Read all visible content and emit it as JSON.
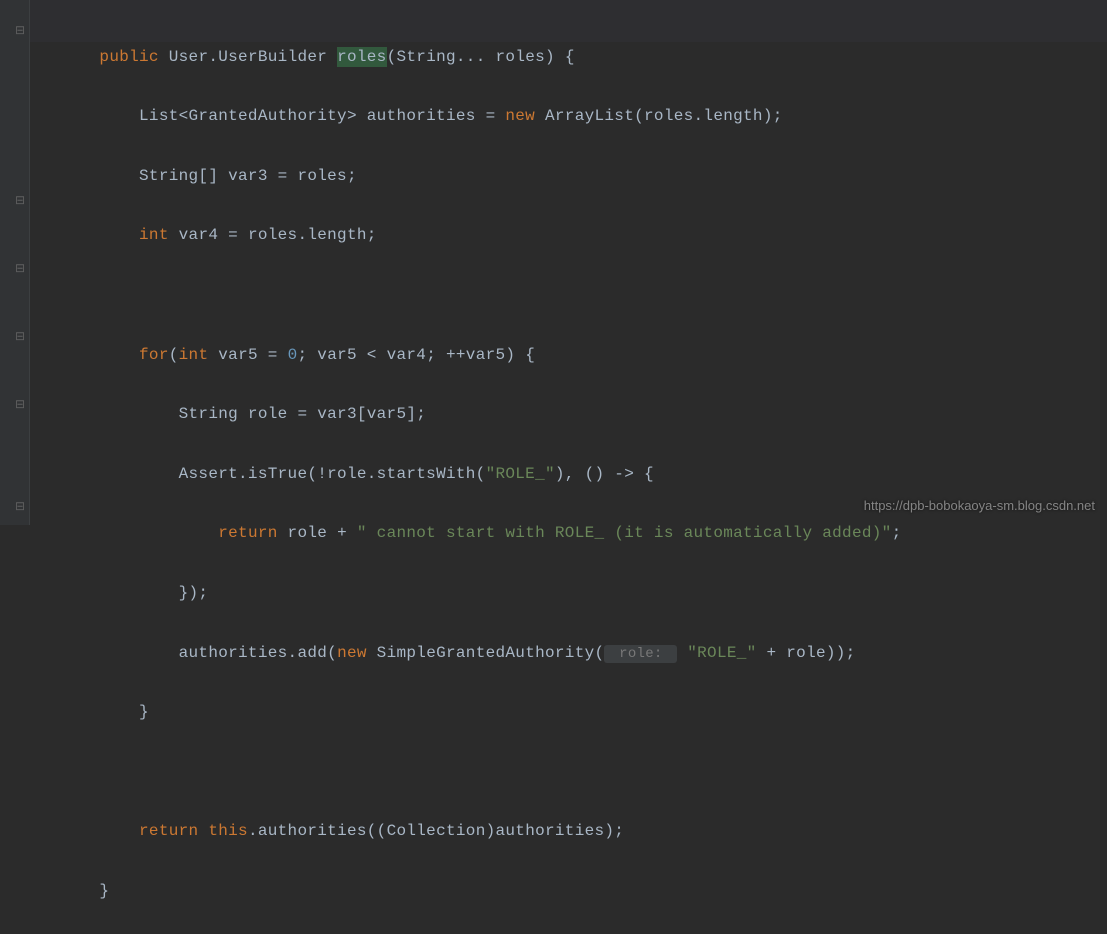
{
  "code": {
    "l1_public": "public",
    "l1_type": " User.UserBuilder ",
    "l1_method": "roles",
    "l1_params": "(String... roles) {",
    "l2_a": "List<GrantedAuthority> authorities = ",
    "l2_new": "new",
    "l2_b": " ArrayList(roles.length);",
    "l3": "String[] var3 = roles;",
    "l4_int": "int",
    "l4_rest": " var4 = roles.length;",
    "l5_for": "for",
    "l5_a": "(",
    "l5_int": "int",
    "l5_b": " var5 = ",
    "l5_zero": "0",
    "l5_c": "; var5 < var4; ++var5) {",
    "l6": "String role = var3[var5];",
    "l7_a": "Assert.isTrue(!role.startsWith(",
    "l7_str": "\"ROLE_\"",
    "l7_b": "), () -> {",
    "l8_ret": "return",
    "l8_a": " role + ",
    "l8_str": "\" cannot start with ROLE_ (it is automatically added)\"",
    "l8_b": ";",
    "l9": "});",
    "l10_a": "authorities.add(",
    "l10_new": "new",
    "l10_b": " SimpleGrantedAuthority(",
    "l10_hint": " role: ",
    "l10_str": "\"ROLE_\"",
    "l10_c": " + role));",
    "l11": "}",
    "l12_ret": "return",
    "l12_a": " ",
    "l12_this": "this",
    "l12_b": ".authorities((Collection)authorities);",
    "l13": "}"
  },
  "watermark": "https://dpb-bobokaoya-sm.blog.csdn.net"
}
